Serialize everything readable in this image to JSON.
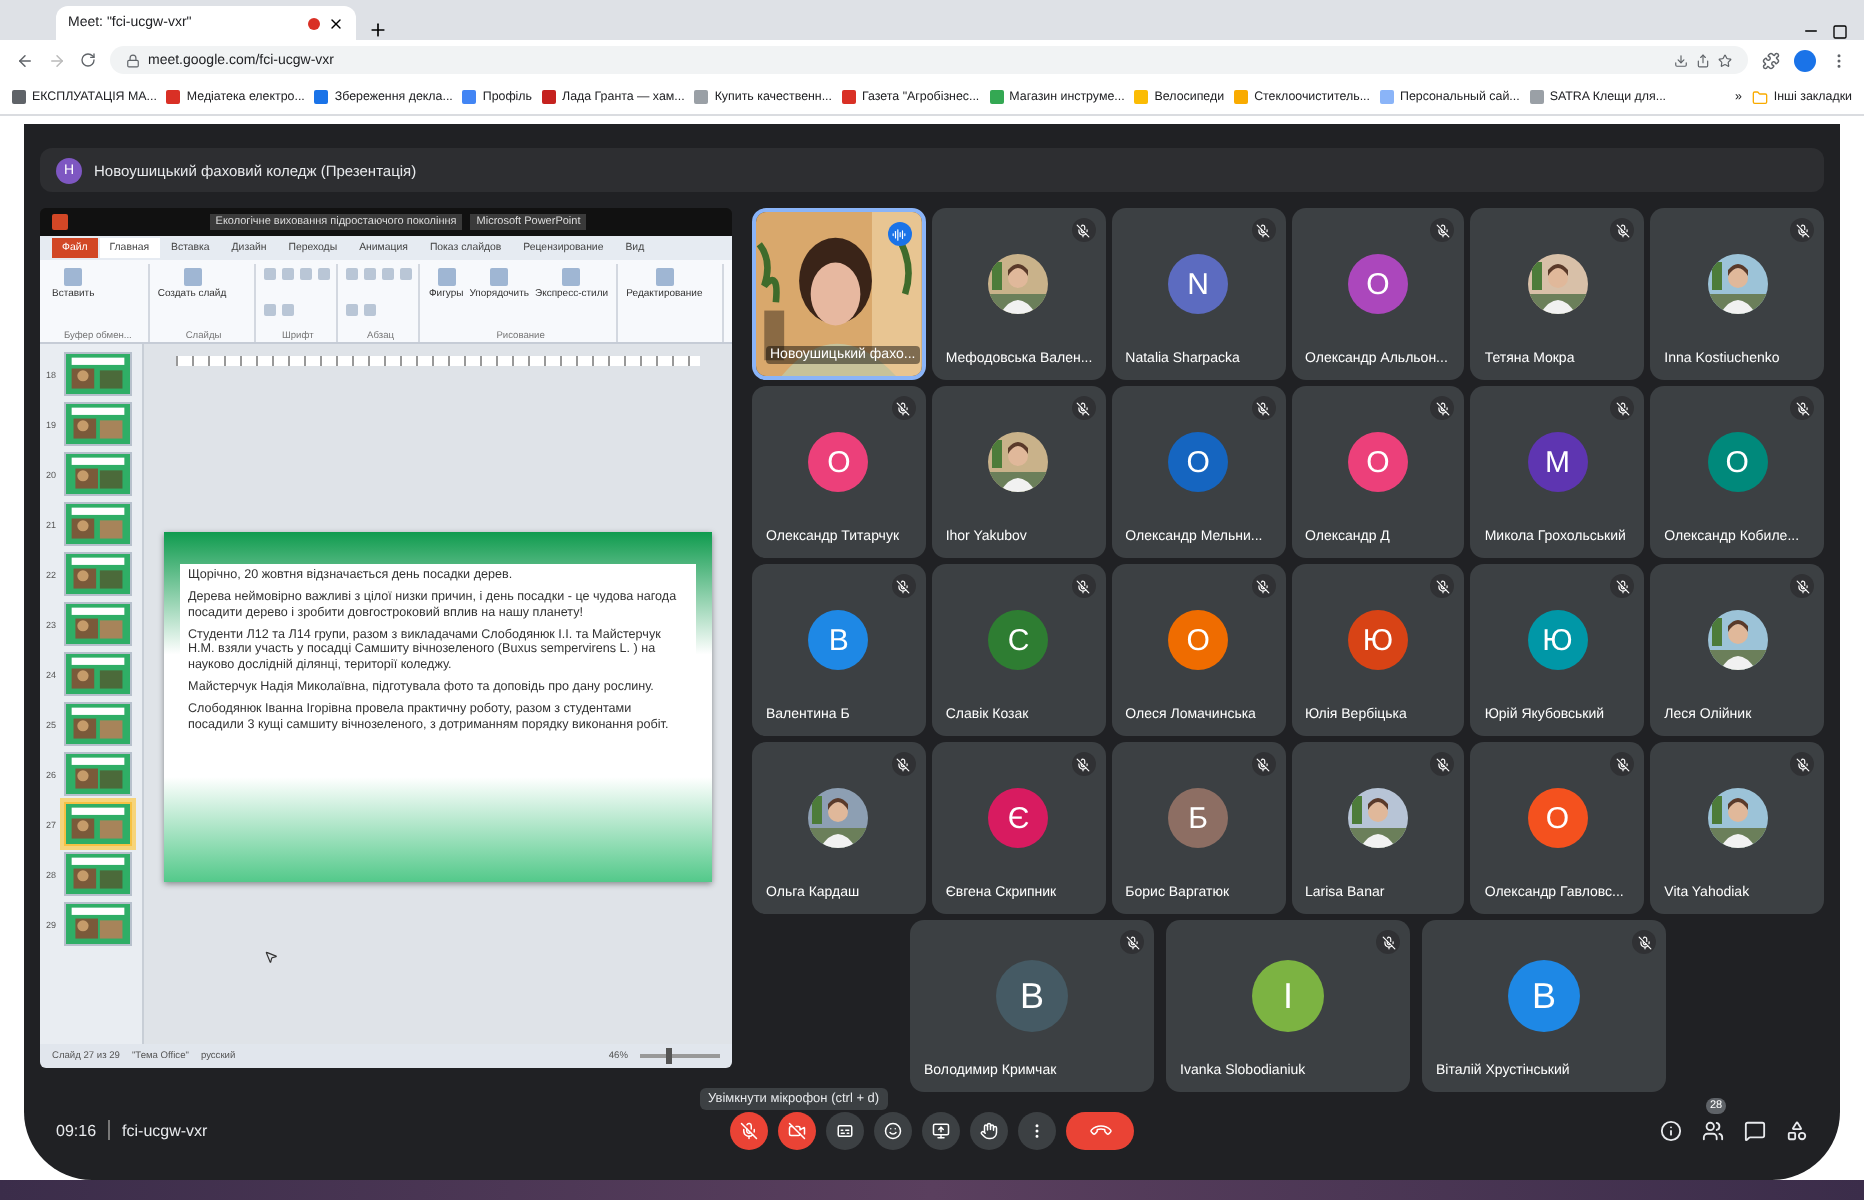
{
  "browser": {
    "tab_title": "Meet: \"fci-ucgw-vxr\"",
    "url": "meet.google.com/fci-ucgw-vxr",
    "bookmarks": [
      {
        "label": "ЕКСПЛУАТАЦІЯ МА...",
        "color": "#5f6368"
      },
      {
        "label": "Медіатека електро...",
        "color": "#d93025"
      },
      {
        "label": "Збереження декла...",
        "color": "#1a73e8"
      },
      {
        "label": "Профіль",
        "color": "#4285f4"
      },
      {
        "label": "Лада Гранта — хам...",
        "color": "#c5221f"
      },
      {
        "label": "Купить качественн...",
        "color": "#9aa0a6"
      },
      {
        "label": "Газета \"Агробізнес...",
        "color": "#d93025"
      },
      {
        "label": "Магазин инструме...",
        "color": "#34a853"
      },
      {
        "label": "Велосипеди",
        "color": "#fbbc04"
      },
      {
        "label": "Стеклоочиститель...",
        "color": "#f9ab00"
      },
      {
        "label": "Персональный сай...",
        "color": "#8ab4f8"
      },
      {
        "label": "SATRA Клещи для...",
        "color": "#9aa0a6"
      }
    ],
    "more_bookmarks": "»",
    "other_bookmarks": "Інші закладки"
  },
  "meet": {
    "title": "Новоушицький фаховий коледж (Презентація)",
    "avatar": {
      "letter": "Н",
      "color": "#7e57c2"
    }
  },
  "presentation": {
    "title": "Екологічне виховання підростаючого покоління",
    "app": "Microsoft PowerPoint",
    "tabs": [
      {
        "label": "Файл",
        "selected": false,
        "kind": "file"
      },
      {
        "label": "Главная",
        "selected": true,
        "kind": "tab"
      },
      {
        "label": "Вставка",
        "selected": false,
        "kind": "tab"
      },
      {
        "label": "Дизайн",
        "selected": false,
        "kind": "tab"
      },
      {
        "label": "Переходы",
        "selected": false,
        "kind": "tab"
      },
      {
        "label": "Анимация",
        "selected": false,
        "kind": "tab"
      },
      {
        "label": "Показ слайдов",
        "selected": false,
        "kind": "tab"
      },
      {
        "label": "Рецензирование",
        "selected": false,
        "kind": "tab"
      },
      {
        "label": "Вид",
        "selected": false,
        "kind": "tab"
      }
    ],
    "groups": [
      {
        "label": "Буфер обмен...",
        "buttons": [
          "Вставить"
        ]
      },
      {
        "label": "Слайды",
        "buttons": [
          "Создать слайд"
        ]
      },
      {
        "label": "Шрифт"
      },
      {
        "label": "Абзац"
      },
      {
        "label": "Рисование",
        "buttons": [
          "Фигуры",
          "Упорядочить",
          "Экспресс-стили"
        ]
      },
      {
        "buttons": [
          "Редактирование"
        ]
      }
    ],
    "thumbnails": [
      {
        "number": "18",
        "selected": false
      },
      {
        "number": "19",
        "selected": false
      },
      {
        "number": "20",
        "selected": false
      },
      {
        "number": "21",
        "selected": false
      },
      {
        "number": "22",
        "selected": false
      },
      {
        "number": "23",
        "selected": false
      },
      {
        "number": "24",
        "selected": false
      },
      {
        "number": "25",
        "selected": false
      },
      {
        "number": "26",
        "selected": false
      },
      {
        "number": "27",
        "selected": true
      },
      {
        "number": "28",
        "selected": false
      },
      {
        "number": "29",
        "selected": false
      }
    ],
    "slide_paragraphs": [
      "Щорічно, 20 жовтня відзначається день посадки дерев.",
      "Дерева неймовірно важливі з цілої низки причин, і день посадки - це чудова нагода посадити дерево і зробити довгостроковий вплив на нашу планету!",
      "Студенти Л12 та Л14 групи, разом з викладачами Слободянюк І.І. та Майстерчук Н.М. взяли участь у посадці Самшиту вічнозеленого (Buxus sempervirens L. ) на науково дослідній ділянці, території коледжу.",
      "Майстерчук Надія Миколаївна, підготувала фото та доповідь про дану рослину.",
      "Слободянюк Іванна Ігорівна провела практичну роботу, разом з студентами посадили 3 кущі самшиту вічнозеленого, з дотриманням порядку виконання робіт."
    ],
    "status": [
      "Слайд 27 из 29",
      "\"Тема Office\"",
      "русский"
    ],
    "zoom": "46%",
    "zoom_slider": {
      "level": 0.35
    }
  },
  "participants": [
    {
      "name": "Новоушицький фахо...",
      "kind": "video",
      "muted": false
    },
    {
      "name": "Мефодовська Вален...",
      "muted": true
    },
    {
      "name": "Natalia Sharpacka",
      "kind": "letter",
      "letter": "N",
      "color": "#5c6bc0",
      "muted": true
    },
    {
      "name": "Олександр Альльон...",
      "kind": "letter",
      "letter": "О",
      "color": "#ab47bc",
      "muted": true
    },
    {
      "name": "Тетяна Мокра",
      "muted": true
    },
    {
      "name": "Inna Kostiuchenko",
      "muted": true
    },
    {
      "name": "Олександр Титарчук",
      "kind": "letter",
      "letter": "О",
      "color": "#ec407a",
      "muted": true
    },
    {
      "name": "Ihor Yakubov",
      "muted": true
    },
    {
      "name": "Олександр Мельни...",
      "kind": "letter",
      "letter": "О",
      "color": "#1565c0",
      "muted": true
    },
    {
      "name": "Олександр Д",
      "kind": "letter",
      "letter": "О",
      "color": "#ec407a",
      "muted": true
    },
    {
      "name": "Микола Грохольський",
      "kind": "letter",
      "letter": "М",
      "color": "#5e35b1",
      "muted": true
    },
    {
      "name": "Олександр Кобиле...",
      "kind": "letter",
      "letter": "О",
      "color": "#00897b",
      "muted": true
    },
    {
      "name": "Валентина Б",
      "kind": "letter",
      "letter": "В",
      "color": "#1e88e5",
      "muted": true
    },
    {
      "name": "Славік Козак",
      "kind": "letter",
      "letter": "С",
      "color": "#2e7d32",
      "muted": true
    },
    {
      "name": "Олеся Ломачинська",
      "kind": "letter",
      "letter": "О",
      "color": "#ef6c00",
      "muted": true
    },
    {
      "name": "Юлія Вербіцька",
      "kind": "letter",
      "letter": "Ю",
      "color": "#d84315",
      "muted": true
    },
    {
      "name": "Юрій Якубовський",
      "kind": "letter",
      "letter": "Ю",
      "color": "#0097a7",
      "muted": true
    },
    {
      "name": "Леся Олійник",
      "muted": true
    },
    {
      "name": "Ольга Кардаш",
      "muted": true
    },
    {
      "name": "Євгена Скрипник",
      "kind": "letter",
      "letter": "Є",
      "color": "#d81b60",
      "muted": true
    },
    {
      "name": "Борис Варгатюк",
      "kind": "letter",
      "letter": "Б",
      "color": "#8d6e63",
      "muted": true
    },
    {
      "name": "Larisa Banar",
      "muted": true
    },
    {
      "name": "Олександр Гавловс...",
      "kind": "letter",
      "letter": "О",
      "color": "#f4511e",
      "muted": true
    },
    {
      "name": "Vita Yahodiak",
      "muted": true
    },
    {
      "name": "Володимир Кримчак",
      "kind": "letter",
      "letter": "В",
      "color": "#455a64",
      "muted": true
    },
    {
      "name": "Ivanka Slobodianiuk",
      "kind": "letter",
      "letter": "І",
      "color": "#7cb342",
      "muted": true
    },
    {
      "name": "Віталій Хрустінський",
      "kind": "letter",
      "letter": "В",
      "color": "#1e88e5",
      "muted": true
    }
  ],
  "bottom_bar": {
    "time": "09:16",
    "meeting_code": "fci-ucgw-vxr",
    "tooltip": "Увімкнути мікрофон (ctrl + d)",
    "people_count": "28",
    "controls": [
      {
        "kind": "mic",
        "off": true
      },
      {
        "kind": "camera",
        "off": true
      },
      {
        "kind": "captions",
        "off": false
      },
      {
        "kind": "emoji",
        "off": false
      },
      {
        "kind": "present",
        "off": false
      },
      {
        "kind": "hand",
        "off": false
      },
      {
        "kind": "more",
        "off": false
      },
      {
        "kind": "hangup",
        "off": true
      }
    ]
  }
}
